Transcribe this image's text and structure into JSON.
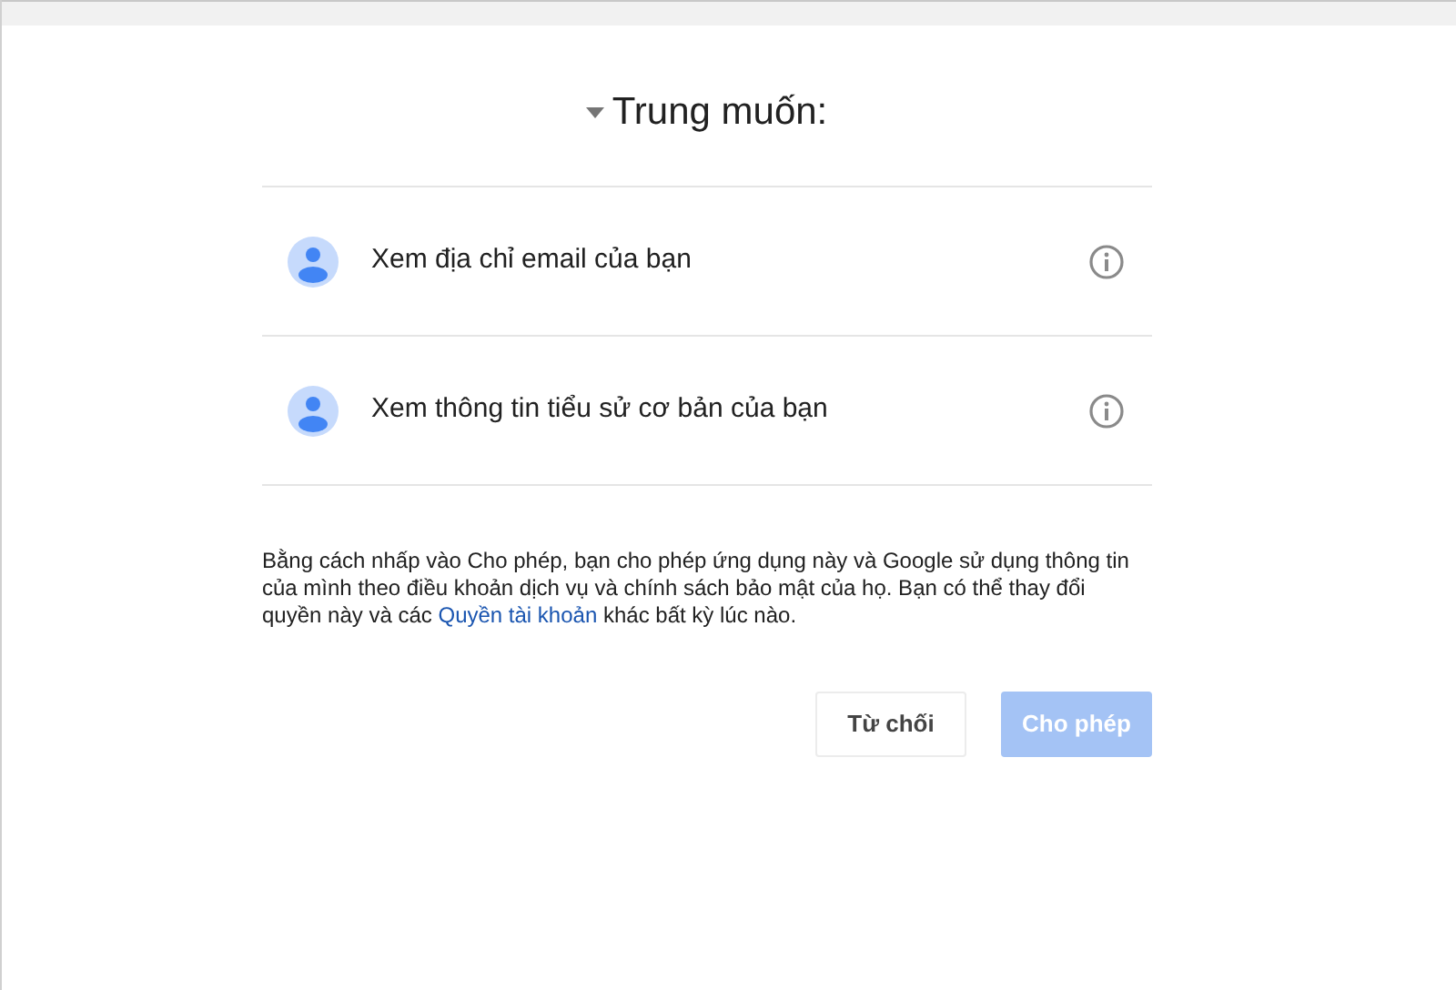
{
  "title": {
    "text": "Trung muốn:",
    "expanded": true
  },
  "permissions": [
    {
      "label": "Xem địa chỉ email của bạn"
    },
    {
      "label": "Xem thông tin tiểu sử cơ bản của bạn"
    }
  ],
  "notice": {
    "before": "Bằng cách nhấp vào Cho phép, bạn cho phép ứng dụng này và Google sử dụng thông tin của mình theo điều khoản dịch vụ và chính sách bảo mật của họ. Bạn có thể thay đổi quyền này và các ",
    "link": "Quyền tài khoản",
    "after": " khác bất kỳ lúc nào."
  },
  "buttons": [
    {
      "label": "Từ chối",
      "kind": "secondary",
      "disabled": false
    },
    {
      "label": "Cho phép",
      "kind": "primary",
      "disabled": true
    }
  ]
}
